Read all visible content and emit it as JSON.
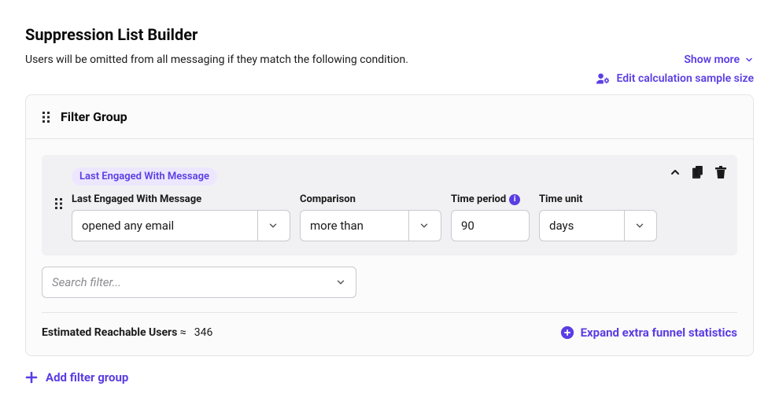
{
  "header": {
    "title": "Suppression List Builder",
    "subtitle": "Users will be omitted from all messaging if they match the following condition.",
    "show_more": "Show more",
    "edit_calc": "Edit calculation sample size"
  },
  "filter_group": {
    "title": "Filter Group",
    "rule_chip": "Last Engaged With Message",
    "fields": {
      "engage_label": "Last Engaged With Message",
      "engage_value": "opened any email",
      "comparison_label": "Comparison",
      "comparison_value": "more than",
      "time_period_label": "Time period",
      "time_period_value": "90",
      "time_unit_label": "Time unit",
      "time_unit_value": "days"
    },
    "search_placeholder": "Search filter..."
  },
  "stats": {
    "label": "Estimated Reachable Users",
    "value": "346",
    "expand": "Expand extra funnel statistics"
  },
  "add_group": "Add filter group"
}
